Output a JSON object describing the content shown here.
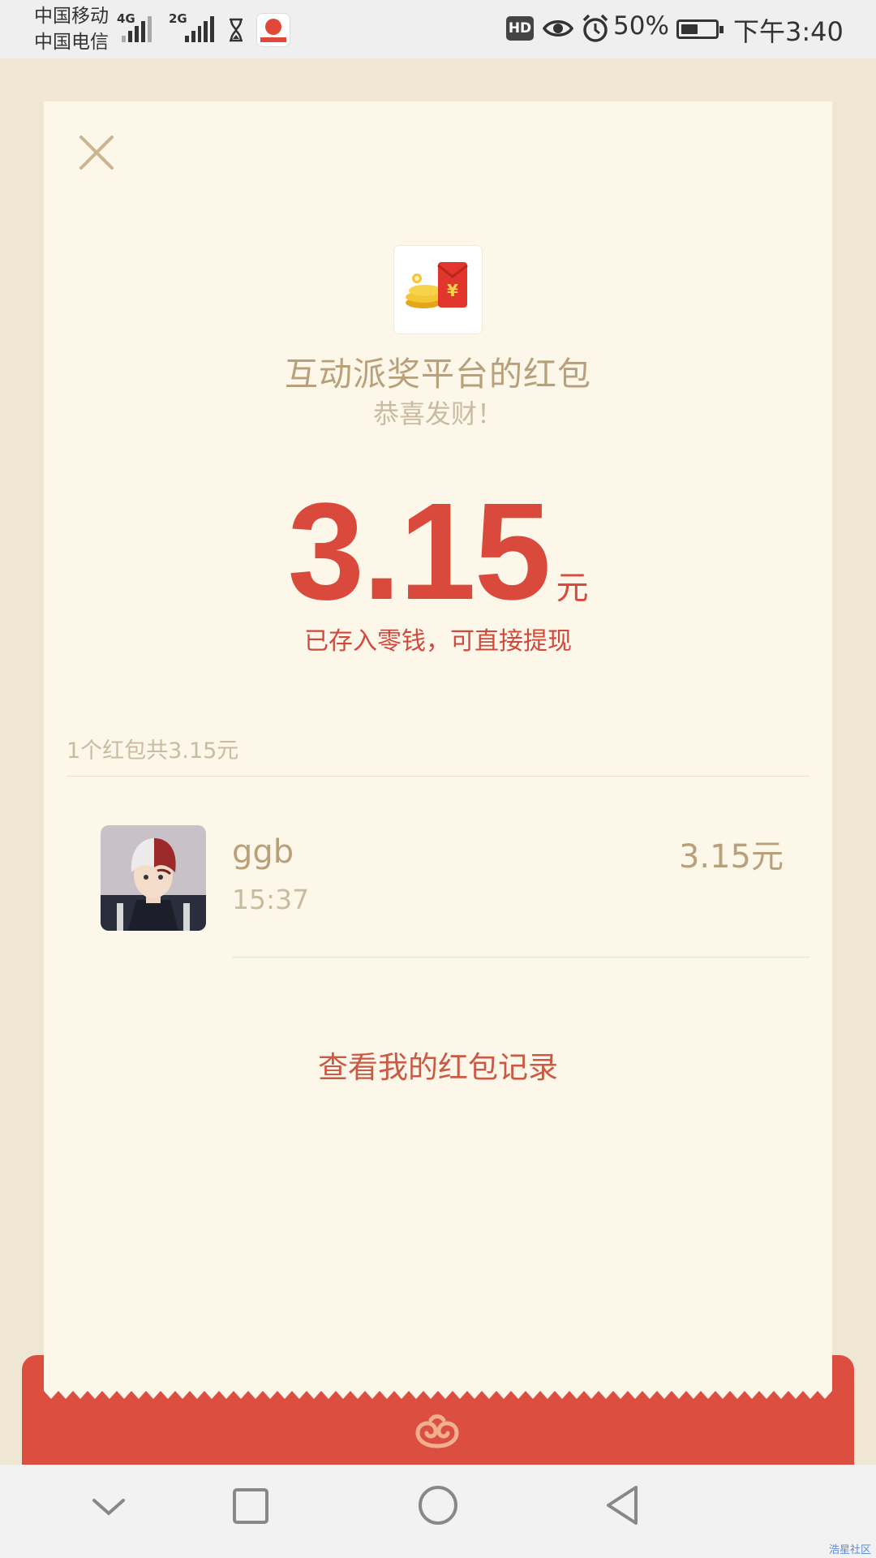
{
  "status_bar": {
    "carrier_1": "中国移动",
    "carrier_2": "中国电信",
    "net_1": "4G",
    "net_2": "2G",
    "hd_badge": "HD",
    "battery_percent": "50%",
    "battery_level": 0.5,
    "time": "下午3:40",
    "icons": [
      "signal-icon",
      "hourglass-icon",
      "app-notification-icon",
      "eye-icon",
      "alarm-icon",
      "battery-icon"
    ]
  },
  "red_packet": {
    "sender_title": "互动派奖平台的红包",
    "greeting": "恭喜发财！",
    "amount": "3.15",
    "unit": "元",
    "stored_note": "已存入零钱，可直接提现",
    "summary": "1个红包共3.15元",
    "history_link": "查看我的红包记录"
  },
  "recipients": [
    {
      "name": "ggb",
      "time": "15:37",
      "amount": "3.15元"
    }
  ],
  "footer": {
    "watermark": "浩星社区"
  },
  "colors": {
    "accent_red": "#d94a3d",
    "card_bg": "#fdf7ea",
    "gold_text": "#b8a07a",
    "envelope_red": "#dc4f40"
  }
}
